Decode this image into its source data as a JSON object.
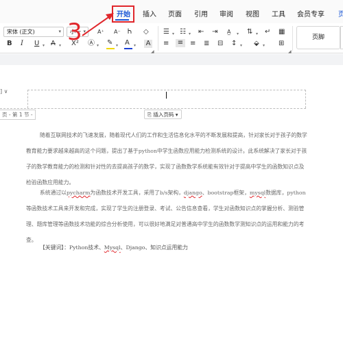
{
  "tabs": [
    "开始",
    "插入",
    "页面",
    "引用",
    "审阅",
    "视图",
    "工具",
    "会员专享",
    "页"
  ],
  "toolbar": {
    "font_name": "宋体 (正文)",
    "font_size": "小一",
    "style_label": "页脚"
  },
  "annotation": {
    "number": "3"
  },
  "document": {
    "header_left_mark": "] ∨",
    "section_label": "页 - 第 1 节 -",
    "insert_page_number_label": "插入页码",
    "paragraph1": "随着互联网技术的飞速发展，随着现代人们的工作和生活信息化水平的不断发展和提高，针对家长对于孩子的数学教育能力要求越来越高的这个问题，提出了基于python中学生函数应用能力检测系统的设计。此系统解决了家长对于孩子的数学教育能力的检测和针对性的去提高孩子的数学，实现了函数数学系统能有效针对于提高中学生的函数知识点及检验函数应用能力。",
    "paragraph2_parts": [
      "系统通过以",
      "pycharm",
      "为函数技术开发工具，采用了b/s架构，",
      "django",
      "、bootstrap框架，",
      "mysql",
      "数据库，python等函数技术工具来开发和完成，实现了学生的注册登录、考试、公告信息查看，学生对函数知识点的掌握分析、测验管理、题库管理等函数技术功能的综合分析使用，可以很好地满足对普通高中学生的函数数学测知识点的运用和能力的考查。"
    ],
    "keywords_parts": [
      "【关键词】：Python技术、",
      "Mysql",
      "、Django、知识点运用能力"
    ]
  }
}
